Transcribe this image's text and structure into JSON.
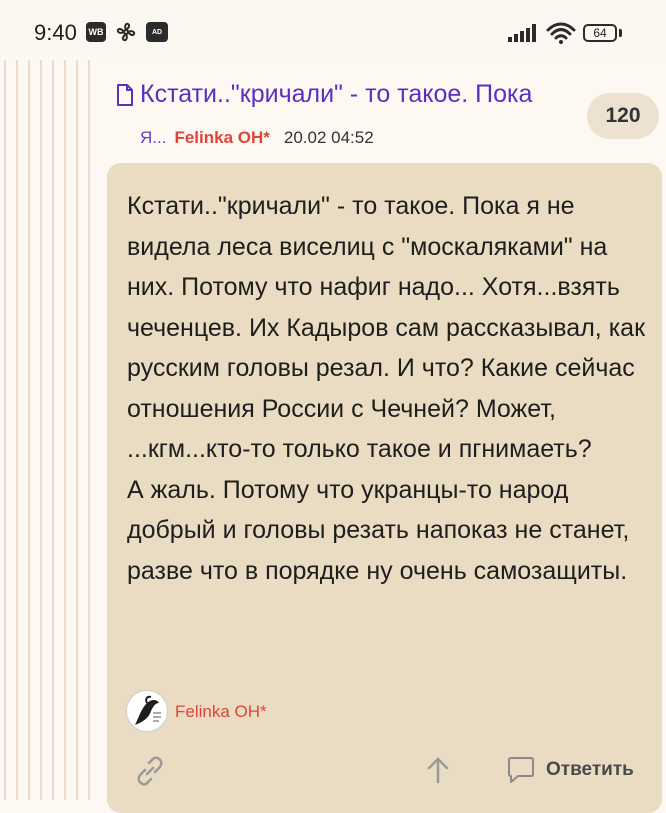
{
  "status_bar": {
    "time": "9:40",
    "wb_badge": "WB",
    "ad_badge": "AD",
    "battery": "64"
  },
  "post": {
    "title": "Кстати..\"кричали\" - то такое. Пока",
    "reply_count": "120",
    "meta_prefix": "Я...",
    "author": "Felinka ОН*",
    "date": "20.02 04:52",
    "body": [
      "Кстати..\"кричали\" - то такое. Пока я не видела леса виселиц с \"москаляками\" на них. Потому что нафиг надо... Хотя...взять чеченцев. Их Кадыров сам рассказывал, как русским головы резал. И что? Какие сейчас отношения России с Чечней? Может, ...кгм...кто-то только такое и пгнимаеть?",
      "А жаль. Потому что укранцы-то народ добрый и головы резать напоказ не станет, разве что в порядке ну очень самозащиты."
    ],
    "signature_author": "Felinka ОН*"
  },
  "actions": {
    "reply_label": "Ответить"
  },
  "colors": {
    "title": "#5a2fc0",
    "author": "#e0443a",
    "card_bg": "#e9dcc2",
    "page_bg": "#fdf9f2"
  },
  "icons": [
    "document-icon",
    "link-icon",
    "arrow-up-icon",
    "comment-icon",
    "wifi-icon",
    "signal-icon",
    "battery-icon",
    "fan-icon"
  ]
}
